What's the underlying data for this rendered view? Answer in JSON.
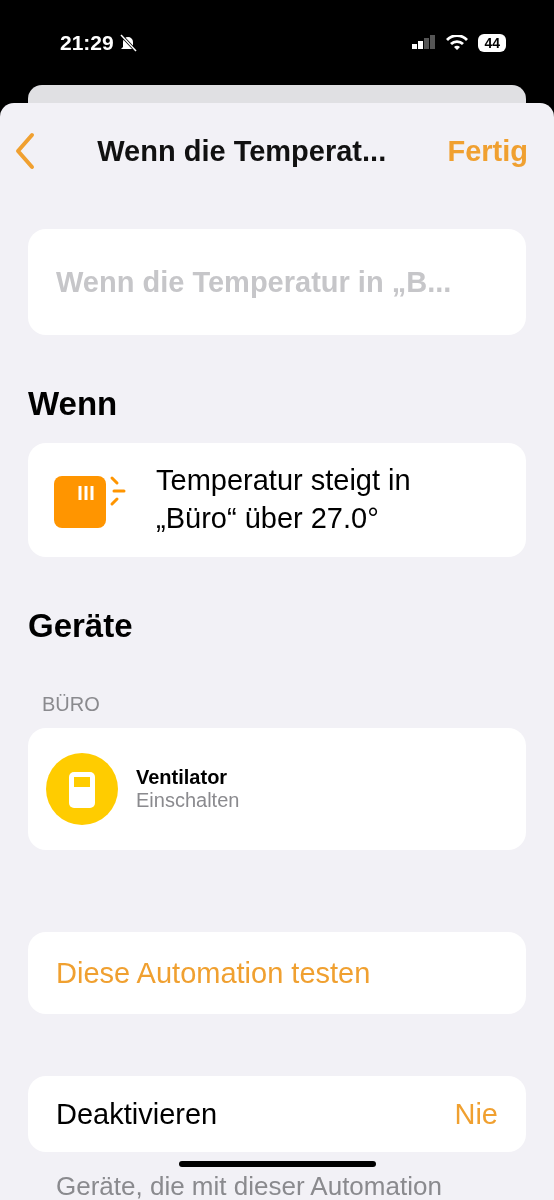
{
  "status_bar": {
    "time": "21:29",
    "battery": "44",
    "silent": true
  },
  "nav": {
    "title": "Wenn die Temperat...",
    "done": "Fertig"
  },
  "name_field": {
    "placeholder": "Wenn die Temperatur in „B..."
  },
  "trigger_section": {
    "heading": "Wenn",
    "trigger": "Temperatur steigt in „Büro“ über 27.0°"
  },
  "devices_section": {
    "heading": "Geräte",
    "room": "BÜRO",
    "devices": [
      {
        "name": "Ventilator",
        "action": "Einschalten"
      }
    ]
  },
  "test_button": "Diese Automation testen",
  "deactivate": {
    "label": "Deaktivieren",
    "value": "Nie"
  },
  "footer_note": "Geräte, die mit dieser Automation"
}
